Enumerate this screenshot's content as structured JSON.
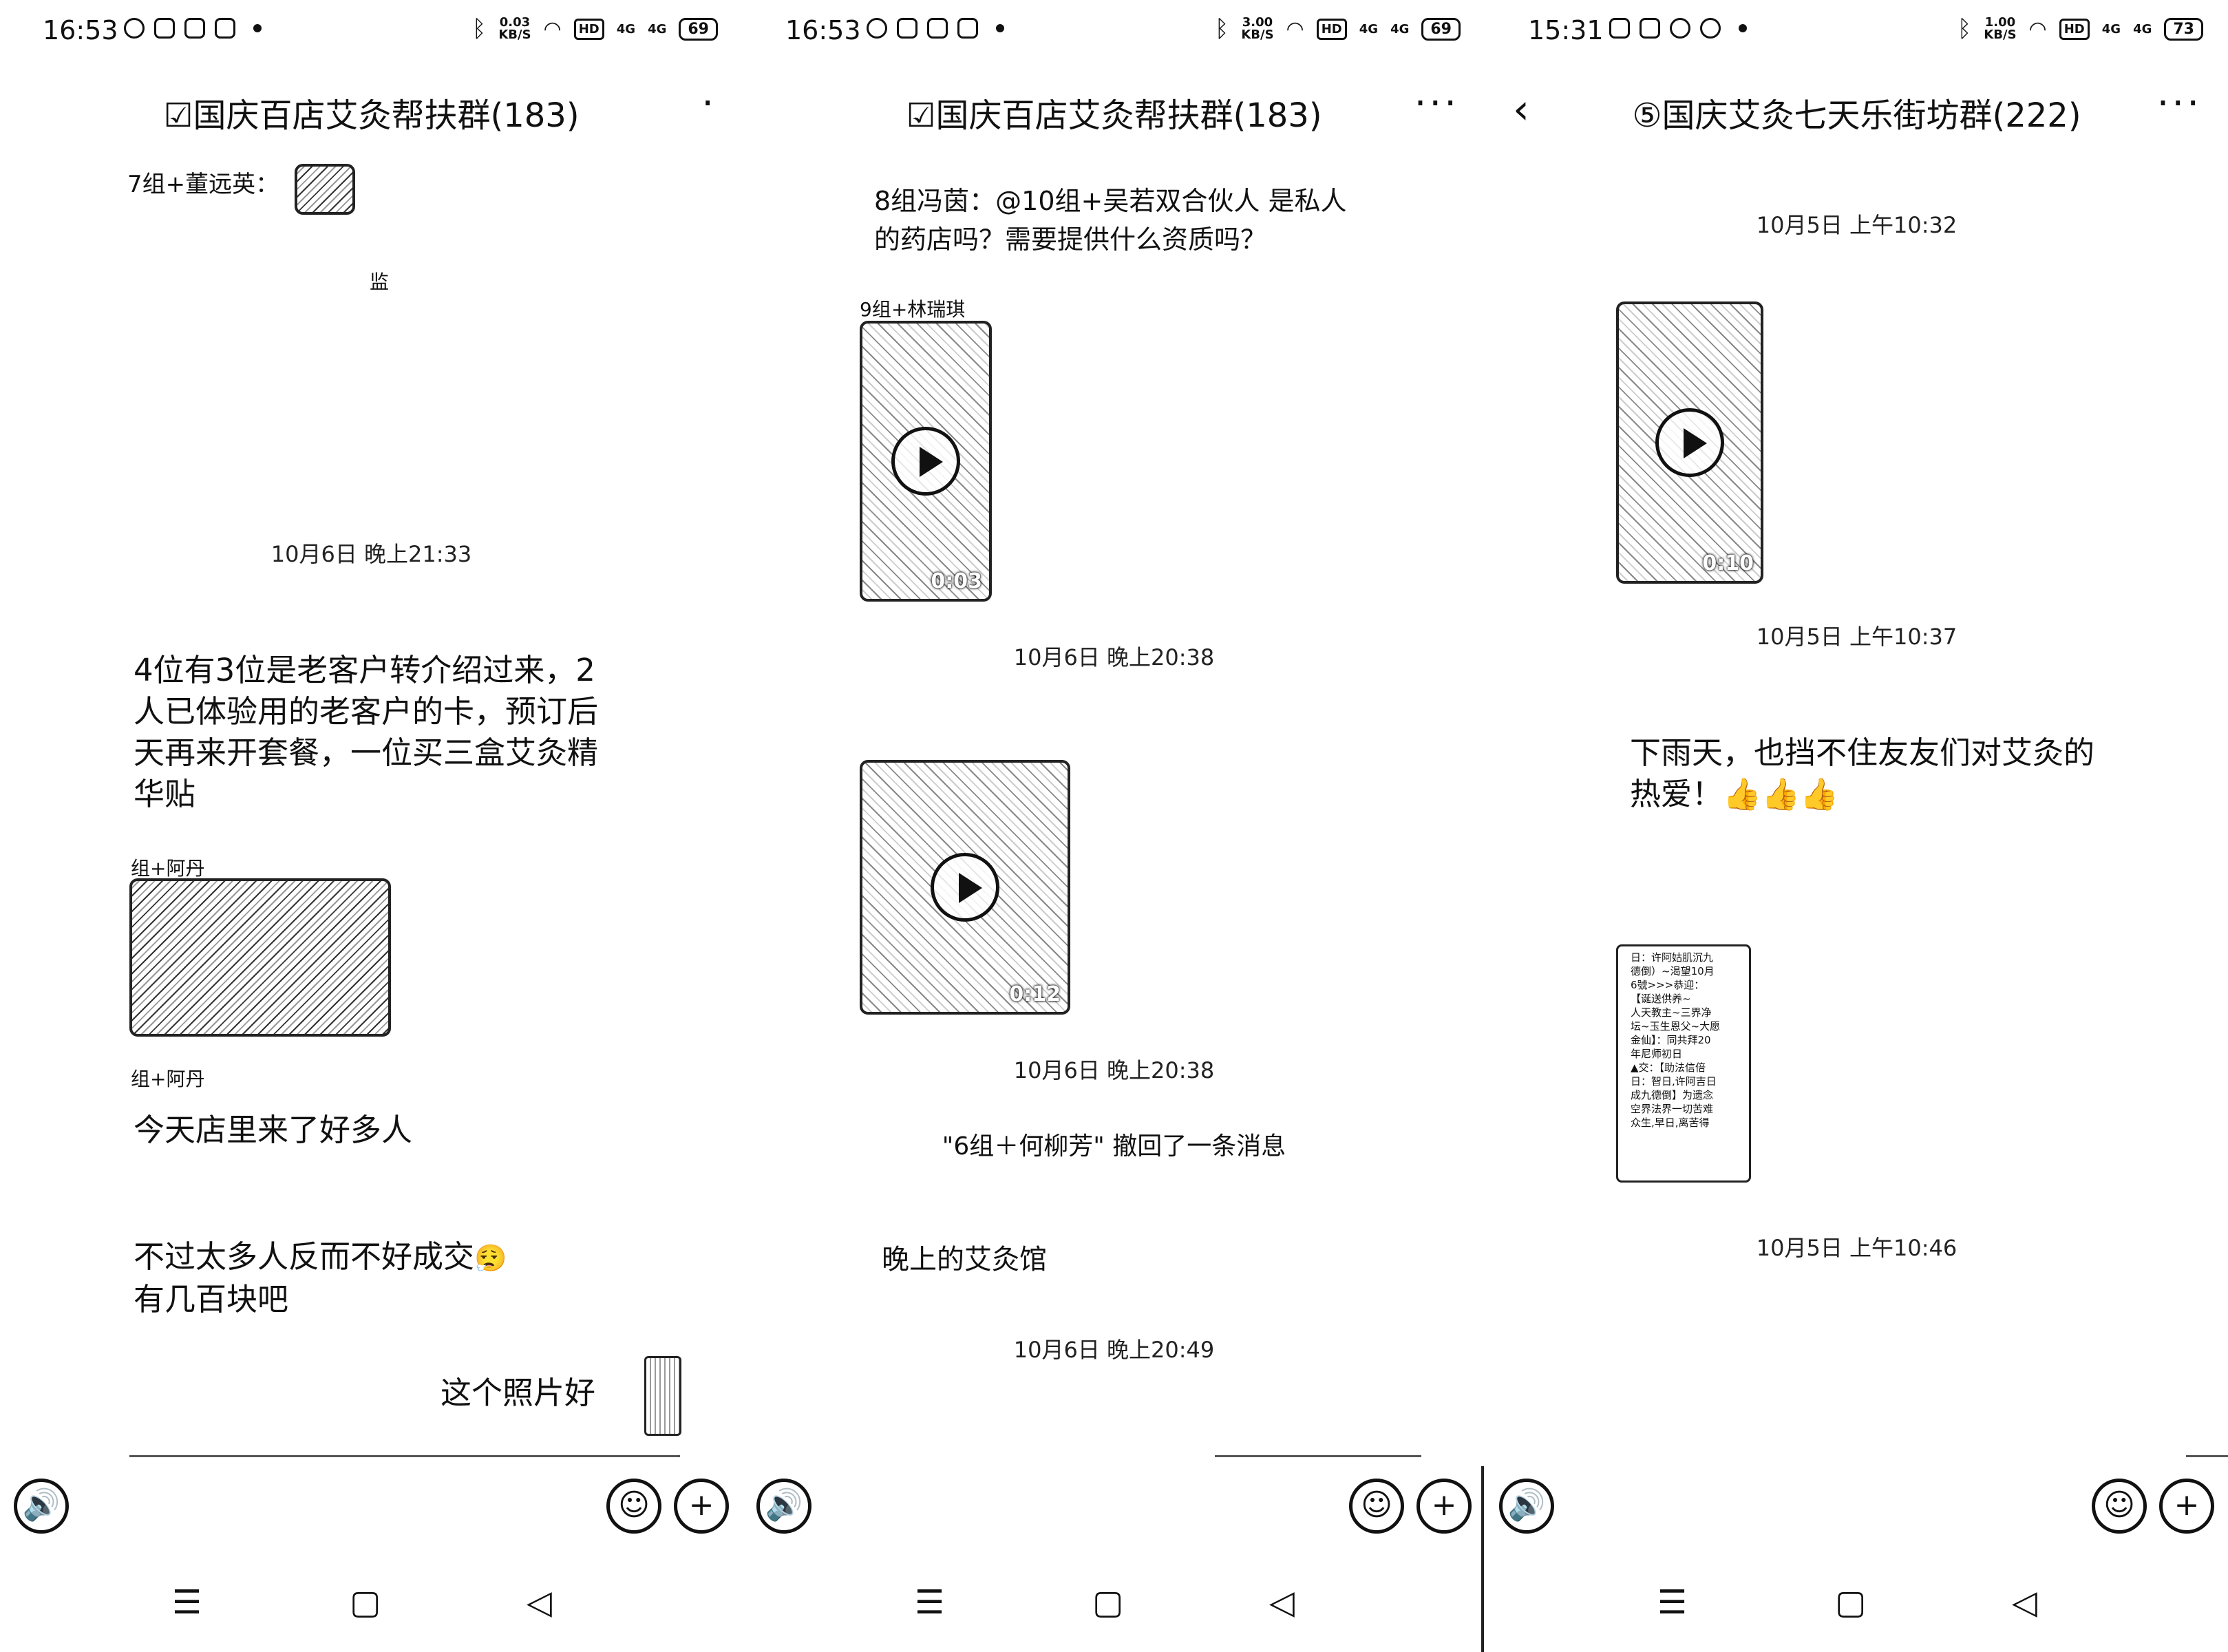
{
  "panels": [
    {
      "status": {
        "time": "16:53",
        "speed_value": "0.03",
        "speed_unit": "KB/S",
        "hd": "HD",
        "sig1": "4G",
        "sig2": "4G",
        "battery": "69"
      },
      "title": "☑国庆百店艾灸帮扶群(183)",
      "more": "·",
      "sender_top": "7组+董远英：",
      "fragment": "监",
      "timestamp1": "10月6日 晚上21:33",
      "message1": "4位有3位是老客户转介绍过来，2人已体验用的老客户的卡，预订后天再来开套餐，一位买三盒艾灸精华贴",
      "sender_photo": "组+阿丹",
      "sender_below": "组+阿丹",
      "message2": "今天店里来了好多人",
      "message3_line1": "不过太多人反而不好成交",
      "message3_line2": "有几百块吧",
      "message3_emoji": "😮‍💨",
      "own_message": "这个照片好",
      "nav": {
        "menu": "☰",
        "home": "▢",
        "back": "◁"
      },
      "input": {
        "voice": "🔊",
        "emoji": "☺",
        "plus": "+"
      }
    },
    {
      "status": {
        "time": "16:53",
        "speed_value": "3.00",
        "speed_unit": "KB/S",
        "hd": "HD",
        "sig1": "4G",
        "sig2": "4G",
        "battery": "69"
      },
      "title": "☑国庆百店艾灸帮扶群(183)",
      "more": "···",
      "message1": "8组冯茵：@10组+吴若双合伙人 是私人的药店吗？需要提供什么资质吗？",
      "sender_video": "9组+林瑞琪",
      "video1_duration": "0:03",
      "timestamp1": "10月6日 晚上20:38",
      "video2_duration": "0:12",
      "timestamp2": "10月6日 晚上20:38",
      "recall": "\"6组＋何柳芳\" 撤回了一条消息",
      "message2": "晚上的艾灸馆",
      "timestamp3": "10月6日 晚上20:49",
      "nav": {
        "menu": "☰",
        "home": "▢",
        "back": "◁"
      },
      "input": {
        "voice": "🔊",
        "emoji": "☺",
        "plus": "+"
      }
    },
    {
      "status": {
        "time": "15:31",
        "speed_value": "1.00",
        "speed_unit": "KB/S",
        "hd": "HD",
        "sig1": "4G",
        "sig2": "4G",
        "battery": "73"
      },
      "title": "⑤国庆艾灸七天乐街坊群(222)",
      "back": "‹",
      "more": "···",
      "timestamp1": "10月5日 上午10:32",
      "video1_duration": "0:10",
      "timestamp2": "10月5日 上午10:37",
      "message1": "下雨天，也挡不住友友们对艾灸的热爱！👍👍👍",
      "doc_lines": [
        "日：许阿姑肌沉九",
        "德倒）~渴望10月",
        "6號>>>恭迎：",
        "【诞送供养~",
        "人天教主~三界净",
        "坛~玉生恩父~大愿",
        "金仙】：同共拜20",
        "年尼师初日",
        "▲交：【助法信倍",
        "日：智日,许阿吉日",
        "成九德倒】为遗念",
        "空界法界一切苦难",
        "众生,早日,离苦得"
      ],
      "timestamp3": "10月5日 上午10:46",
      "nav": {
        "menu": "☰",
        "home": "▢",
        "back": "◁"
      },
      "input": {
        "voice": "🔊",
        "emoji": "☺",
        "plus": "+"
      }
    }
  ]
}
